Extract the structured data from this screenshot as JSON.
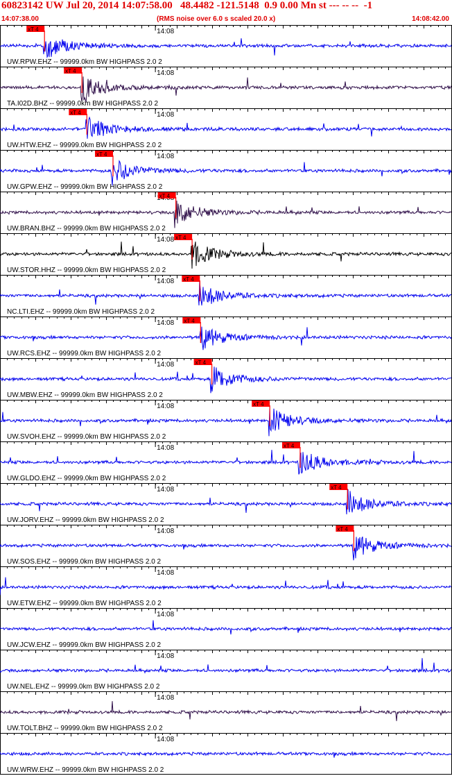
{
  "header": {
    "title": "60823142 UW Jul 20, 2014 14:07:58.00   48.4482 -121.5148  0.9 0.00 Mn st --- -- --  -1",
    "start_time": "14:07:38.00",
    "note": "(RMS noise over 6.0 s scaled 20.0 x)",
    "end_time": "14:08:42.00"
  },
  "minute_label": "14:08",
  "pick_label": "xT 4",
  "colors": {
    "accent": "#e00000",
    "trace_blue": "#0000ee",
    "trace_dark": "#30104a",
    "trace_black": "#000000",
    "pick_fill": "#ff0000"
  },
  "traces": [
    {
      "label": "UW.RPW.EHZ -- 99999.0km BW  HIGHPASS  2.0  2",
      "color": "#0000ee",
      "pick_time": 6.3
    },
    {
      "label": "TA.I02D.BHZ -- 99999.0km BW  HIGHPASS  2.0  2",
      "color": "#30104a",
      "pick_time": 11.6
    },
    {
      "label": "UW.HTW.EHZ -- 99999.0km BW  HIGHPASS  2.0  2",
      "color": "#0000ee",
      "pick_time": 12.3
    },
    {
      "label": "UW.GPW.EHZ -- 99999.0km BW  HIGHPASS  2.0  2",
      "color": "#0000ee",
      "pick_time": 16.0
    },
    {
      "label": "UW.BRAN.BHZ -- 99999.0km BW  HIGHPASS  2.0  2",
      "color": "#30104a",
      "pick_time": 24.9
    },
    {
      "label": "UW.STOR.HHZ -- 99999.0km BW  HIGHPASS  2.0  2",
      "color": "#000000",
      "pick_time": 27.2
    },
    {
      "label": "NC.LTI.EHZ -- 99999.0km BW  HIGHPASS  2.0  2",
      "color": "#0000ee",
      "pick_time": 28.3
    },
    {
      "label": "UW.RCS.EHZ -- 99999.0km BW  HIGHPASS  2.0  2",
      "color": "#0000ee",
      "pick_time": 28.4
    },
    {
      "label": "UW.MBW.EHZ -- 99999.0km BW  HIGHPASS  2.0  2",
      "color": "#0000ee",
      "pick_time": 30.0
    },
    {
      "label": "UW.SVOH.EHZ -- 99999.0km BW  HIGHPASS  2.0  2",
      "color": "#0000ee",
      "pick_time": 38.2
    },
    {
      "label": "UW.GLDO.EHZ -- 99999.0km BW  HIGHPASS  2.0  2",
      "color": "#0000ee",
      "pick_time": 42.5
    },
    {
      "label": "UW.JORV.EHZ -- 99999.0km BW  HIGHPASS  2.0  2",
      "color": "#0000ee",
      "pick_time": 49.2
    },
    {
      "label": "UW.SOS.EHZ -- 99999.0km BW  HIGHPASS  2.0  2",
      "color": "#0000ee",
      "pick_time": 50.1
    },
    {
      "label": "UW.ETW.EHZ -- 99999.0km BW  HIGHPASS  2.0  2",
      "color": "#0000ee",
      "pick_time": null
    },
    {
      "label": "UW.JCW.EHZ -- 99999.0km BW  HIGHPASS  2.0  2",
      "color": "#0000ee",
      "pick_time": null
    },
    {
      "label": "UW.NEL.EHZ -- 99999.0km BW  HIGHPASS  2.0  2",
      "color": "#0000ee",
      "pick_time": null
    },
    {
      "label": "UW.TOLT.BHZ -- 99999.0km BW  HIGHPASS  2.0  2",
      "color": "#30104a",
      "pick_time": null
    },
    {
      "label": "UW.WRW.EHZ -- 99999.0km BW  HIGHPASS  2.0  2",
      "color": "#0000ee",
      "pick_time": null
    }
  ]
}
